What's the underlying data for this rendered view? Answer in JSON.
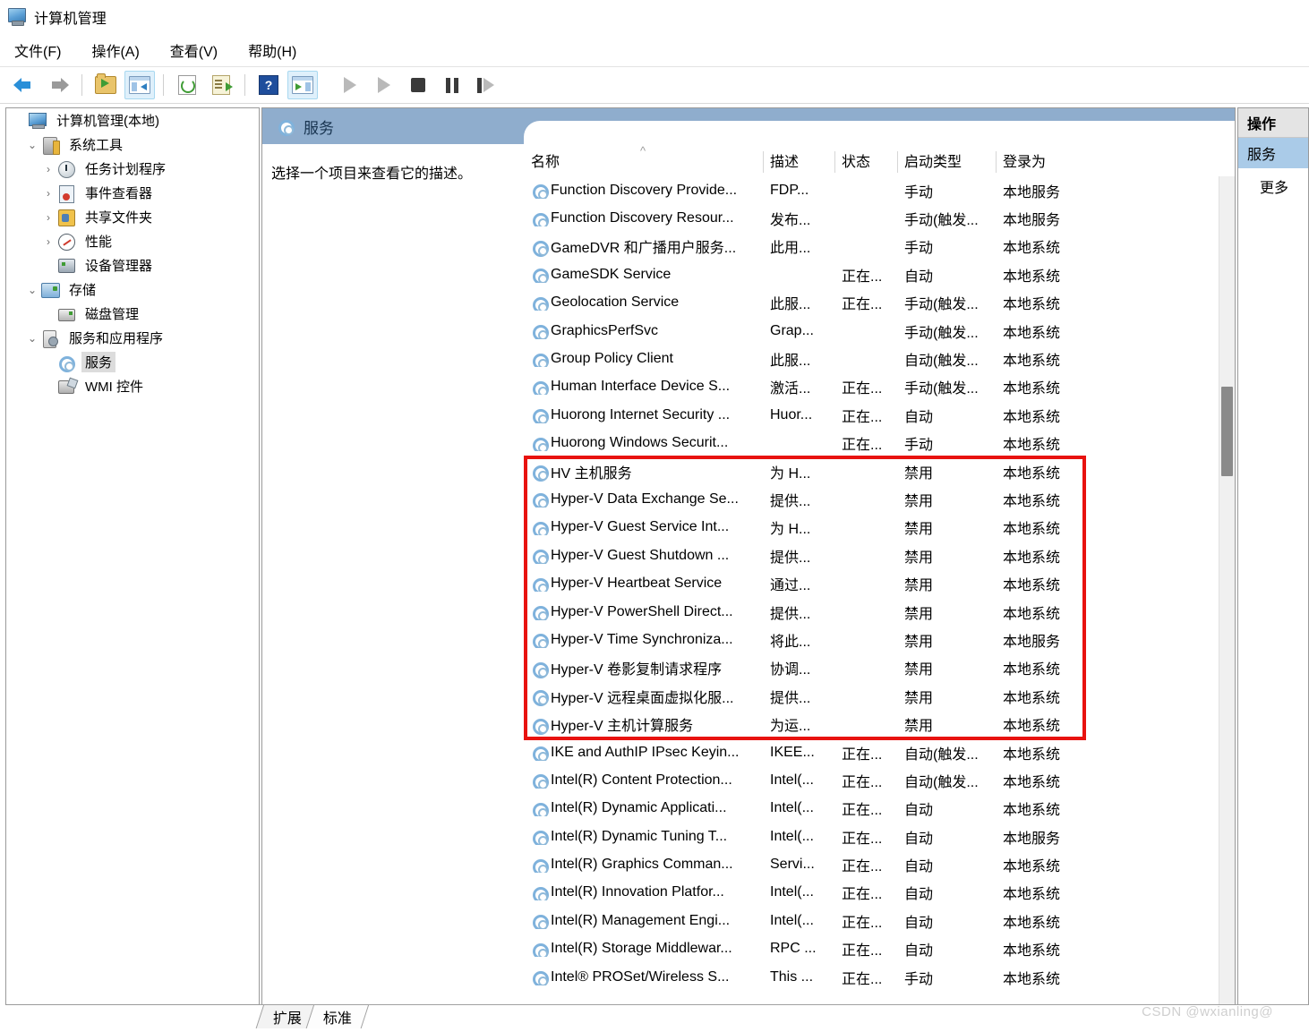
{
  "window": {
    "title": "计算机管理",
    "icon": "computer-management-icon"
  },
  "menubar": {
    "items": [
      "文件(F)",
      "操作(A)",
      "查看(V)",
      "帮助(H)"
    ]
  },
  "toolbar": {
    "buttons": [
      {
        "name": "back-arrow-icon",
        "label": "后退"
      },
      {
        "name": "forward-arrow-icon",
        "label": "前进"
      },
      {
        "name": "up-folder-icon",
        "label": "向上"
      },
      {
        "name": "show-hide-console-tree-icon",
        "label": "显示/隐藏控制台树"
      },
      {
        "name": "refresh-icon",
        "label": "刷新"
      },
      {
        "name": "export-list-icon",
        "label": "导出列表"
      },
      {
        "name": "help-icon",
        "label": "帮助"
      },
      {
        "name": "show-hide-action-pane-icon",
        "label": "显示/隐藏操作窗格"
      },
      {
        "name": "start-service-icon",
        "label": "启动服务"
      },
      {
        "name": "resume-service-icon",
        "label": "恢复服务"
      },
      {
        "name": "stop-service-icon",
        "label": "停止服务"
      },
      {
        "name": "pause-service-icon",
        "label": "暂停服务"
      },
      {
        "name": "restart-service-icon",
        "label": "重启服务"
      }
    ]
  },
  "tree": {
    "nodes": [
      {
        "label": "计算机管理(本地)",
        "depth": 0,
        "expander": "",
        "icon": "computer-icon",
        "selected": false
      },
      {
        "label": "系统工具",
        "depth": 1,
        "expander": "⌄",
        "icon": "system-tools-icon",
        "selected": false
      },
      {
        "label": "任务计划程序",
        "depth": 2,
        "expander": "›",
        "icon": "task-scheduler-icon",
        "selected": false
      },
      {
        "label": "事件查看器",
        "depth": 2,
        "expander": "›",
        "icon": "event-viewer-icon",
        "selected": false
      },
      {
        "label": "共享文件夹",
        "depth": 2,
        "expander": "›",
        "icon": "shared-folders-icon",
        "selected": false
      },
      {
        "label": "性能",
        "depth": 2,
        "expander": "›",
        "icon": "performance-icon",
        "selected": false
      },
      {
        "label": "设备管理器",
        "depth": 2,
        "expander": "",
        "icon": "device-manager-icon",
        "selected": false
      },
      {
        "label": "存储",
        "depth": 1,
        "expander": "⌄",
        "icon": "storage-icon",
        "selected": false
      },
      {
        "label": "磁盘管理",
        "depth": 2,
        "expander": "",
        "icon": "disk-management-icon",
        "selected": false
      },
      {
        "label": "服务和应用程序",
        "depth": 1,
        "expander": "⌄",
        "icon": "services-and-applications-icon",
        "selected": false
      },
      {
        "label": "服务",
        "depth": 2,
        "expander": "",
        "icon": "services-icon",
        "selected": true
      },
      {
        "label": "WMI 控件",
        "depth": 2,
        "expander": "",
        "icon": "wmi-control-icon",
        "selected": false
      }
    ]
  },
  "content": {
    "header_title": "服务",
    "header_icon": "services-gear-icon",
    "description": "选择一个项目来查看它的描述。",
    "columns": [
      "名称",
      "描述",
      "状态",
      "启动类型",
      "登录为"
    ],
    "sort_column": "名称",
    "sort_direction": "ascending",
    "rows": [
      {
        "name": "Function Discovery Provide...",
        "desc": "FDP...",
        "state": "",
        "start": "手动",
        "login": "本地服务"
      },
      {
        "name": "Function Discovery Resour...",
        "desc": "发布...",
        "state": "",
        "start": "手动(触发...",
        "login": "本地服务"
      },
      {
        "name": "GameDVR 和广播用户服务...",
        "desc": "此用...",
        "state": "",
        "start": "手动",
        "login": "本地系统"
      },
      {
        "name": "GameSDK Service",
        "desc": "",
        "state": "正在...",
        "start": "自动",
        "login": "本地系统"
      },
      {
        "name": "Geolocation Service",
        "desc": "此服...",
        "state": "正在...",
        "start": "手动(触发...",
        "login": "本地系统"
      },
      {
        "name": "GraphicsPerfSvc",
        "desc": "Grap...",
        "state": "",
        "start": "手动(触发...",
        "login": "本地系统"
      },
      {
        "name": "Group Policy Client",
        "desc": "此服...",
        "state": "",
        "start": "自动(触发...",
        "login": "本地系统"
      },
      {
        "name": "Human Interface Device S...",
        "desc": "激活...",
        "state": "正在...",
        "start": "手动(触发...",
        "login": "本地系统"
      },
      {
        "name": "Huorong Internet Security ...",
        "desc": "Huor...",
        "state": "正在...",
        "start": "自动",
        "login": "本地系统"
      },
      {
        "name": "Huorong Windows Securit...",
        "desc": "",
        "state": "正在...",
        "start": "手动",
        "login": "本地系统"
      },
      {
        "name": "HV 主机服务",
        "desc": "为 H...",
        "state": "",
        "start": "禁用",
        "login": "本地系统"
      },
      {
        "name": "Hyper-V Data Exchange Se...",
        "desc": "提供...",
        "state": "",
        "start": "禁用",
        "login": "本地系统"
      },
      {
        "name": "Hyper-V Guest Service Int...",
        "desc": "为 H...",
        "state": "",
        "start": "禁用",
        "login": "本地系统"
      },
      {
        "name": "Hyper-V Guest Shutdown ...",
        "desc": "提供...",
        "state": "",
        "start": "禁用",
        "login": "本地系统"
      },
      {
        "name": "Hyper-V Heartbeat Service",
        "desc": "通过...",
        "state": "",
        "start": "禁用",
        "login": "本地系统"
      },
      {
        "name": "Hyper-V PowerShell Direct...",
        "desc": "提供...",
        "state": "",
        "start": "禁用",
        "login": "本地系统"
      },
      {
        "name": "Hyper-V Time Synchroniza...",
        "desc": "将此...",
        "state": "",
        "start": "禁用",
        "login": "本地服务"
      },
      {
        "name": "Hyper-V 卷影复制请求程序",
        "desc": "协调...",
        "state": "",
        "start": "禁用",
        "login": "本地系统"
      },
      {
        "name": "Hyper-V 远程桌面虚拟化服...",
        "desc": "提供...",
        "state": "",
        "start": "禁用",
        "login": "本地系统"
      },
      {
        "name": "Hyper-V 主机计算服务",
        "desc": "为运...",
        "state": "",
        "start": "禁用",
        "login": "本地系统"
      },
      {
        "name": "IKE and AuthIP IPsec Keyin...",
        "desc": "IKEE...",
        "state": "正在...",
        "start": "自动(触发...",
        "login": "本地系统"
      },
      {
        "name": "Intel(R) Content Protection...",
        "desc": "Intel(...",
        "state": "正在...",
        "start": "自动(触发...",
        "login": "本地系统"
      },
      {
        "name": "Intel(R) Dynamic Applicati...",
        "desc": "Intel(...",
        "state": "正在...",
        "start": "自动",
        "login": "本地系统"
      },
      {
        "name": "Intel(R) Dynamic Tuning T...",
        "desc": "Intel(...",
        "state": "正在...",
        "start": "自动",
        "login": "本地服务"
      },
      {
        "name": "Intel(R) Graphics Comman...",
        "desc": "Servi...",
        "state": "正在...",
        "start": "自动",
        "login": "本地系统"
      },
      {
        "name": "Intel(R) Innovation Platfor...",
        "desc": "Intel(...",
        "state": "正在...",
        "start": "自动",
        "login": "本地系统"
      },
      {
        "name": "Intel(R) Management Engi...",
        "desc": "Intel(...",
        "state": "正在...",
        "start": "自动",
        "login": "本地系统"
      },
      {
        "name": "Intel(R) Storage Middlewar...",
        "desc": "RPC ...",
        "state": "正在...",
        "start": "自动",
        "login": "本地系统"
      },
      {
        "name": "Intel® PROSet/Wireless S...",
        "desc": "This ...",
        "state": "正在...",
        "start": "手动",
        "login": "本地系统"
      }
    ],
    "highlight": {
      "color": "#e8120f",
      "first_row_index": 10,
      "last_row_index": 19
    }
  },
  "actions": {
    "header": "操作",
    "selected_item": "服务",
    "more_label": "更多"
  },
  "tabs": {
    "items": [
      "扩展",
      "标准"
    ],
    "active": "标准"
  },
  "watermark": {
    "text": "CSDN @wxianling@"
  }
}
